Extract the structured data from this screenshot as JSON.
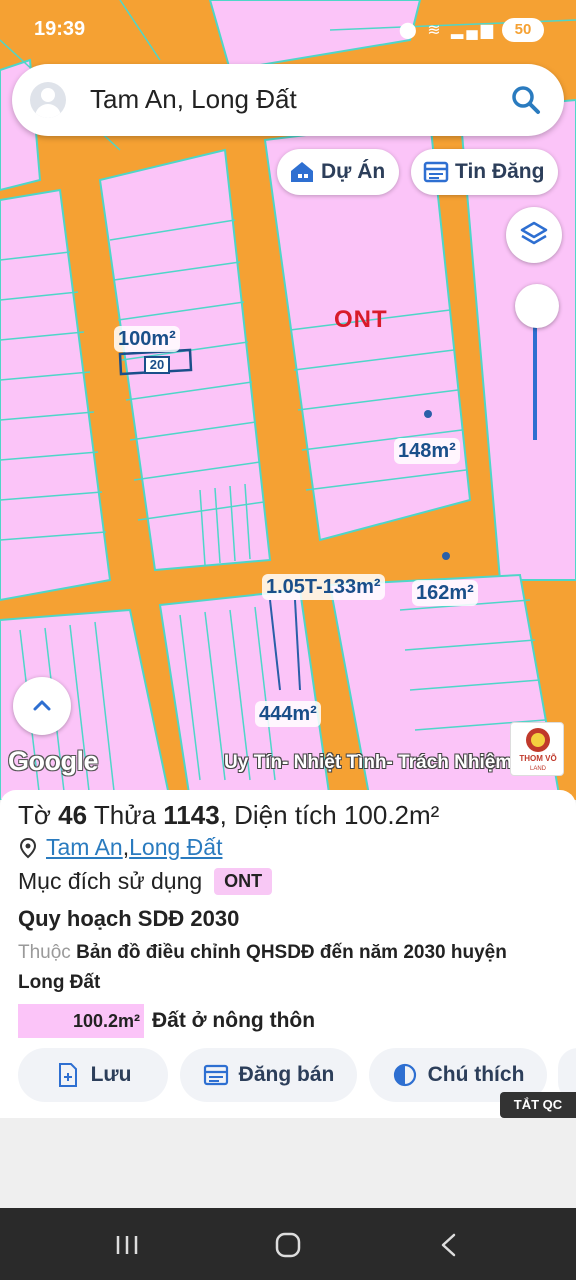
{
  "status_bar": {
    "time": "19:39",
    "battery": "50"
  },
  "search": {
    "query": "Tam An, Long Đất"
  },
  "buttons": {
    "du_an": "Dự Án",
    "tin_dang": "Tin Đăng"
  },
  "map": {
    "zone_code": "ONT",
    "lot_badge": "20",
    "area_labels": [
      "100m²",
      "148m²",
      "1.05T-133m²",
      "162m²",
      "444m²"
    ],
    "watermark": "Uy Tín- Nhiệt Tình- Trách Nhiệm",
    "google_logo": "Google",
    "brand_name": "THOM VÕ",
    "brand_sub": "LAND"
  },
  "panel": {
    "parcel_prefix": "Tờ ",
    "sheet": "46",
    "parcel_mid": " Thửa ",
    "parcel": "1143",
    "area_text": ", Diện tích 100.2m²",
    "location_a": "Tam An",
    "location_sep": ", ",
    "location_b": "Long Đất",
    "purpose_label": "Mục đích sử dụng",
    "purpose_code": "ONT",
    "plan_title": "Quy hoạch SDĐ 2030",
    "plan_prefix": "Thuộc ",
    "plan_desc": "Bản đồ điều chỉnh QHSDĐ đến năm 2030 huyện Long Đất",
    "legend_area": "100.2m²",
    "legend_label": "Đất ở nông thôn",
    "actions": [
      "Lưu",
      "Đăng bán",
      "Chú thích"
    ],
    "ads_badge": "TẮT QC"
  },
  "colors": {
    "road": "#f5a133",
    "land": "#fbc4f8",
    "boundary": "#4fd6c8",
    "accent": "#2e6fd1"
  }
}
